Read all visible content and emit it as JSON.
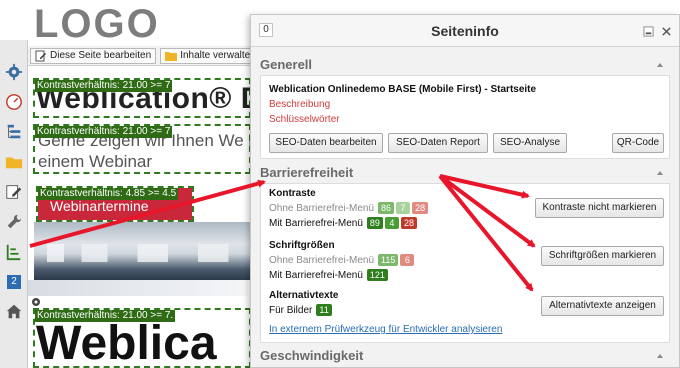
{
  "logo": "LOGO",
  "toolbar": {
    "edit_label": "Diese Seite bearbeiten",
    "manage_label": "Inhalte verwalten"
  },
  "page": {
    "heading": "Weblication® D",
    "subtitle": "Gerne zeigen wir Ihnen We in einem Webinar",
    "button": "Webinartermine",
    "heading2": "Weblica",
    "contrast_tags": [
      "Kontrastverhältnis: 21.00 >= 7",
      "Kontrastverhältnis: 21.00 >= 7",
      "Kontrastverhältnis: 4.85 >= 4.5",
      "Kontrastverhältnis: 21.00 >= 7."
    ]
  },
  "sidebar": {
    "badge": "2"
  },
  "panel": {
    "counter": "0",
    "title": "Seiteninfo",
    "general": {
      "heading": "Generell",
      "site_title": "Weblication Onlinedemo BASE (Mobile First) - Startseite",
      "link_description": "Beschreibung",
      "link_keywords": "Schlüsselwörter",
      "buttons": [
        "SEO-Daten bearbeiten",
        "SEO-Daten Report",
        "SEO-Analyse",
        "QR-Code"
      ]
    },
    "accessibility": {
      "heading": "Barrierefreiheit",
      "contrast": {
        "title": "Kontraste",
        "without_label": "Ohne Barrierefrei-Menü",
        "without_values": [
          "86",
          "7",
          "28"
        ],
        "with_label": "Mit Barrierefrei-Menü",
        "with_values": [
          "89",
          "4",
          "28"
        ],
        "button": "Kontraste nicht markieren"
      },
      "fontsizes": {
        "title": "Schriftgrößen",
        "without_label": "Ohne Barrierefrei-Menü",
        "without_values": [
          "115",
          "6"
        ],
        "with_label": "Mit Barrierefrei-Menü",
        "with_values": [
          "121"
        ],
        "button": "Schriftgrößen markieren"
      },
      "alttexts": {
        "title": "Alternativtexte",
        "images_label": "Für Bilder",
        "images_values": [
          "11"
        ],
        "button": "Alternativtexte anzeigen"
      },
      "external_link": "In externem Prüfwerkzeug für Entwickler analysieren"
    },
    "speed": {
      "heading": "Geschwindigkeit"
    }
  },
  "colors": {
    "badge_green": "#2e7d1f",
    "badge_orange": "#e07a2c",
    "badge_red": "#c0392b",
    "badge_green_light": "#7cb86a",
    "badge_red_light": "#e08a80",
    "arrow_red": "#e8162a"
  }
}
